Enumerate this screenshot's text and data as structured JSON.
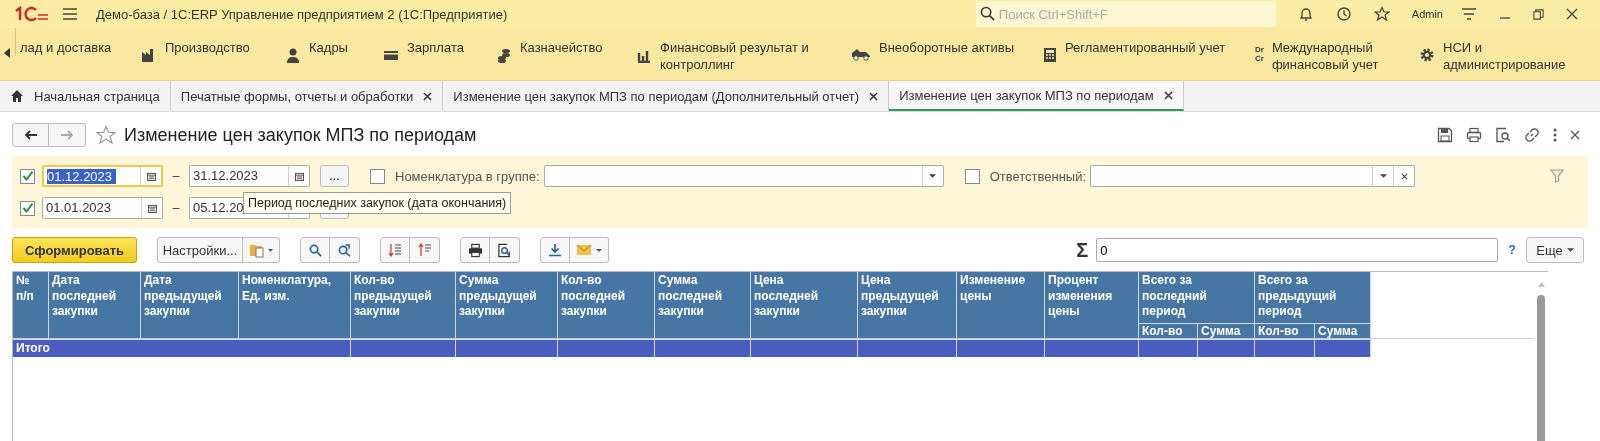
{
  "window": {
    "title": "Демо-база / 1С:ERP Управление предприятием 2  (1С:Предприятие)",
    "search": {
      "placeholder": "Поиск Ctrl+Shift+F"
    },
    "user": "Admin"
  },
  "sections": [
    {
      "label": "лад и доставка"
    },
    {
      "label": "Производство"
    },
    {
      "label": "Кадры"
    },
    {
      "label": "Зарплата"
    },
    {
      "label": "Казначейство"
    },
    {
      "label": "Финансовый результат и контроллинг"
    },
    {
      "label": "Внеоборотные активы"
    },
    {
      "label": "Регламентированный учет"
    },
    {
      "label": "Международный финансовый учет",
      "icon_text": [
        "Dr",
        "Cr"
      ]
    },
    {
      "label": "НСИ и администрирование"
    }
  ],
  "tabs": [
    {
      "label": "Начальная страница",
      "selected": false,
      "closable": false,
      "home": true
    },
    {
      "label": "Печатные формы, отчеты и обработки",
      "selected": false,
      "closable": true,
      "home": false
    },
    {
      "label": "Изменение цен закупок МПЗ по периодам (Дополнительный отчет)",
      "selected": false,
      "closable": true,
      "home": false
    },
    {
      "label": "Изменение цен закупок МПЗ по периодам",
      "selected": true,
      "closable": true,
      "home": false
    }
  ],
  "form": {
    "title": "Изменение цен закупок МПЗ по периодам",
    "periods": [
      {
        "checked": true,
        "from": "01.12.2023",
        "separator": "–",
        "to": "31.12.2023",
        "focused": true,
        "button": "..."
      },
      {
        "checked": true,
        "from": "01.01.2023",
        "separator": "–",
        "to": "05.12.20",
        "focused": false
      }
    ],
    "filters": [
      {
        "label": "Номенклатура в группе:",
        "checked": false,
        "clearable": false
      },
      {
        "label": "Ответственный:",
        "checked": false,
        "clearable": true
      }
    ],
    "tooltip": "Период последних закупок (дата окончания)"
  },
  "toolbar": {
    "generate": "Сформировать",
    "settings": "Настройки...",
    "sum_sign": "Σ",
    "sum_value": "0",
    "help": "?",
    "more": "Еще"
  },
  "table": {
    "columns": [
      {
        "label": "№ п/п"
      },
      {
        "label": "Дата последней закупки"
      },
      {
        "label": "Дата предыдущей закупки"
      },
      {
        "label": "Номенклатура, Ед. изм."
      },
      {
        "label": "Кол-во предыдущей закупки"
      },
      {
        "label": "Сумма предыдущей закупки"
      },
      {
        "label": "Кол-во последней закупки"
      },
      {
        "label": "Сумма последней закупки"
      },
      {
        "label": "Цена последней закупки"
      },
      {
        "label": "Цена предыдущей закупки"
      },
      {
        "label": "Изменение цены"
      },
      {
        "label": "Процент изменения цены"
      },
      {
        "label": "Всего за последний период",
        "children": [
          "Кол-во",
          "Сумма"
        ]
      },
      {
        "label": "Всего за предыдущий период",
        "children": [
          "Кол-во",
          "Сумма"
        ]
      }
    ],
    "total_label": "Итого"
  }
}
